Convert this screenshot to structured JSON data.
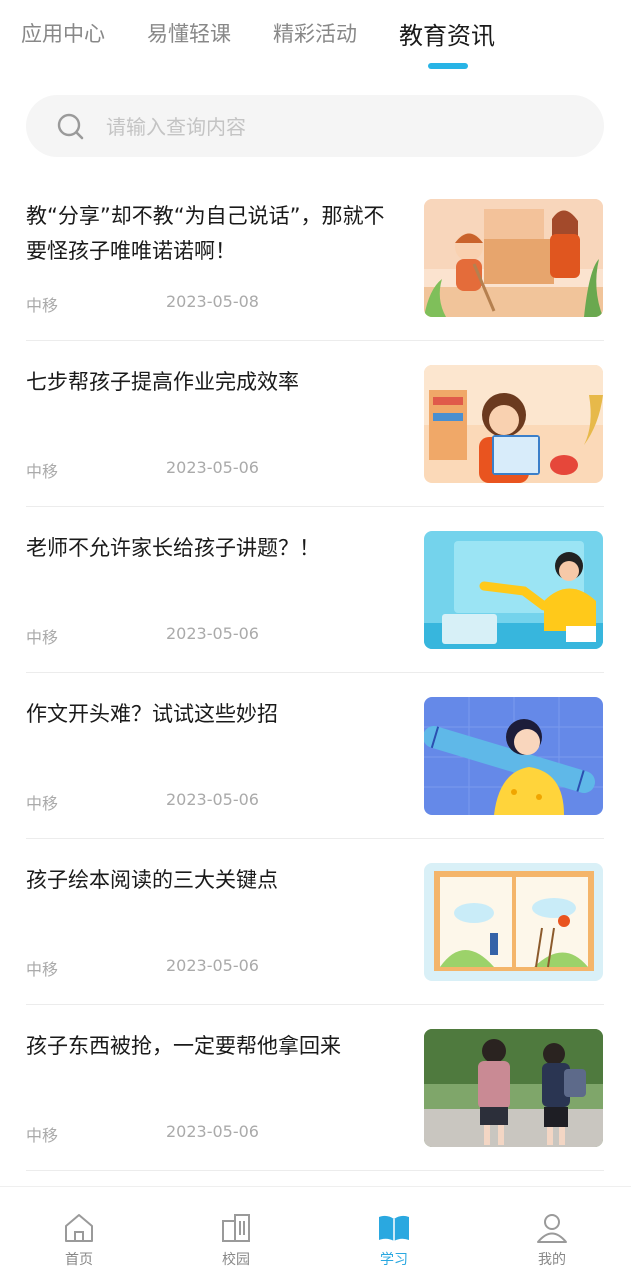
{
  "tabs": [
    {
      "label": "应用中心"
    },
    {
      "label": "易懂轻课"
    },
    {
      "label": "精彩活动"
    },
    {
      "label": "教育资讯",
      "active": true
    }
  ],
  "search": {
    "placeholder": "请输入查询内容",
    "value": "",
    "icon": "search-icon"
  },
  "articles": [
    {
      "title": "教“分享”却不教“为自己说话”，那就不要怪孩子唯唯诺诺啊！",
      "source": "中移",
      "date": "2023-05-08",
      "thumb": "sweeping-girl-illustration"
    },
    {
      "title": "七步帮孩子提高作业完成效率",
      "source": "中移",
      "date": "2023-05-06",
      "thumb": "reading-girl-illustration"
    },
    {
      "title": "老师不允许家长给孩子讲题？！",
      "source": "中移",
      "date": "2023-05-06",
      "thumb": "online-teacher-illustration"
    },
    {
      "title": "作文开头难？试试这些妙招",
      "source": "中移",
      "date": "2023-05-06",
      "thumb": "pencil-girl-illustration"
    },
    {
      "title": "孩子绘本阅读的三大关键点",
      "source": "中移",
      "date": "2023-05-06",
      "thumb": "picture-book-illustration"
    },
    {
      "title": "孩子东西被抢，一定要帮他拿回来",
      "source": "中移",
      "date": "2023-05-06",
      "thumb": "schoolchildren-photo"
    }
  ],
  "bottom_nav": [
    {
      "label": "首页",
      "icon": "home-icon"
    },
    {
      "label": "校园",
      "icon": "campus-icon"
    },
    {
      "label": "学习",
      "icon": "book-icon",
      "active": true
    },
    {
      "label": "我的",
      "icon": "user-icon"
    }
  ],
  "colors": {
    "accent": "#28b4e6",
    "nav_active": "#2aa8e0",
    "text_primary": "#1a1a1a",
    "text_muted": "#aaaaaa"
  }
}
